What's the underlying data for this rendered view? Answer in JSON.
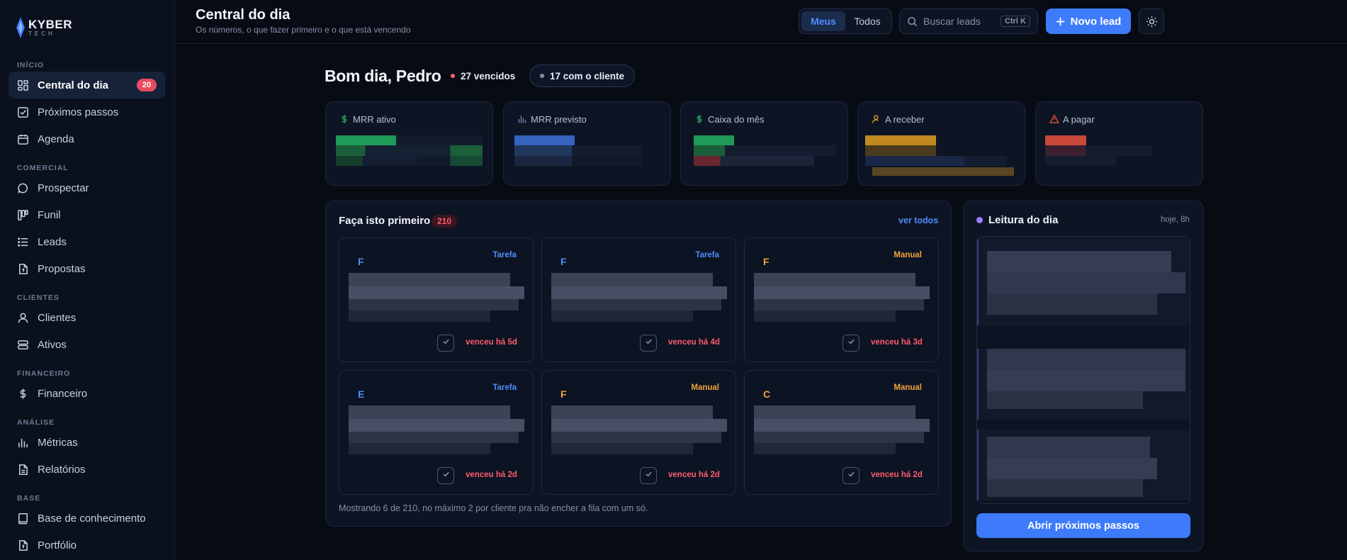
{
  "brand": {
    "name": "KYBER",
    "sub": "TECH"
  },
  "sidebar": {
    "sections": [
      {
        "label": "INÍCIO",
        "items": [
          {
            "label": "Central do dia",
            "icon": "dashboard-icon",
            "badge": "20",
            "active": true
          },
          {
            "label": "Próximos passos",
            "icon": "checkbox-icon"
          },
          {
            "label": "Agenda",
            "icon": "calendar-icon"
          }
        ]
      },
      {
        "label": "COMERCIAL",
        "items": [
          {
            "label": "Prospectar",
            "icon": "chat-icon"
          },
          {
            "label": "Funil",
            "icon": "kanban-icon"
          },
          {
            "label": "Leads",
            "icon": "list-icon"
          },
          {
            "label": "Propostas",
            "icon": "document-icon"
          }
        ]
      },
      {
        "label": "CLIENTES",
        "items": [
          {
            "label": "Clientes",
            "icon": "user-icon"
          },
          {
            "label": "Ativos",
            "icon": "server-icon"
          }
        ]
      },
      {
        "label": "FINANCEIRO",
        "items": [
          {
            "label": "Financeiro",
            "icon": "dollar-icon"
          }
        ]
      },
      {
        "label": "ANÁLISE",
        "items": [
          {
            "label": "Métricas",
            "icon": "bar-chart-icon"
          },
          {
            "label": "Relatórios",
            "icon": "report-icon"
          }
        ]
      },
      {
        "label": "BASE",
        "items": [
          {
            "label": "Base de conhecimento",
            "icon": "book-icon"
          },
          {
            "label": "Portfólio",
            "icon": "portfolio-icon"
          }
        ]
      }
    ]
  },
  "header": {
    "title": "Central do dia",
    "subtitle": "Os números, o que fazer primeiro e o que está vencendo",
    "segment": {
      "mine": "Meus",
      "all": "Todos",
      "selected": "Meus"
    },
    "search": {
      "placeholder": "Buscar leads",
      "shortcut": "Ctrl K"
    },
    "new_lead": "Novo lead"
  },
  "greeting": {
    "text": "Bom dia, Pedro",
    "overdue": "27 vencidos",
    "with_client": "17 com o cliente",
    "overdue_color": "#ff5b6e",
    "with_client_color": "#8590a7"
  },
  "stats": [
    {
      "label": "MRR ativo",
      "icon": "dollar-icon",
      "accent": "#22a861"
    },
    {
      "label": "MRR previsto",
      "icon": "bar-chart-icon",
      "accent": "#3d6fd1"
    },
    {
      "label": "Caixa do mês",
      "icon": "dollar-icon",
      "accent": "#22a861"
    },
    {
      "label": "A receber",
      "icon": "user-money-icon",
      "accent": "#d99a23"
    },
    {
      "label": "A pagar",
      "icon": "warning-icon",
      "accent": "#e0503f"
    }
  ],
  "first": {
    "title": "Faça isto primeiro",
    "count": "210",
    "see_all": "ver todos",
    "footnote": "Mostrando 6 de 210, no máximo 2 por cliente pra não encher a fila com um só.",
    "tasks": [
      {
        "letter": "F",
        "type": "Tarefa",
        "due": "venceu há 5d"
      },
      {
        "letter": "F",
        "type": "Tarefa",
        "due": "venceu há 4d"
      },
      {
        "letter": "F",
        "type": "Manual",
        "due": "venceu há 3d"
      },
      {
        "letter": "E",
        "type": "Tarefa",
        "due": "venceu há 2d"
      },
      {
        "letter": "F",
        "type": "Manual",
        "due": "venceu há 2d"
      },
      {
        "letter": "C",
        "type": "Manual",
        "due": "venceu há 2d"
      }
    ],
    "colors": {
      "Tarefa": "#4f8dff",
      "Manual": "#f0a43a"
    }
  },
  "reading": {
    "title": "Leitura do dia",
    "time": "hoje, 8h",
    "button": "Abrir próximos passos"
  }
}
